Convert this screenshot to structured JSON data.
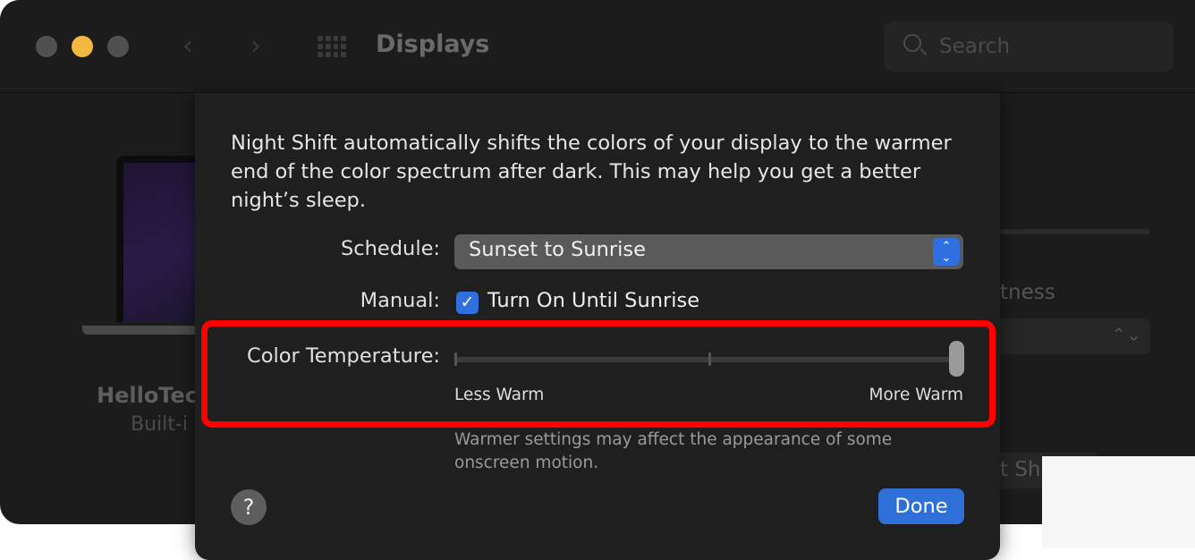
{
  "window": {
    "title": "Displays",
    "search_placeholder": "Search"
  },
  "background": {
    "display_name": "HelloTec",
    "display_sub": "Built-i",
    "brightness_partial": "tness",
    "button_partial": "t Sh"
  },
  "sheet": {
    "description": "Night Shift automatically shifts the colors of your display to the warmer end of the color spectrum after dark. This may help you get a better night’s sleep.",
    "schedule_label": "Schedule:",
    "schedule_value": "Sunset to Sunrise",
    "manual_label": "Manual:",
    "manual_checked": true,
    "manual_option": "Turn On Until Sunrise",
    "color_temp_label": "Color Temperature:",
    "color_temp_value_percent": 100,
    "less_warm": "Less Warm",
    "more_warm": "More Warm",
    "note": "Warmer settings may affect the appearance of some onscreen motion.",
    "help": "?",
    "done": "Done"
  },
  "colors": {
    "accent": "#2f6fd8",
    "highlight": "#ff0000",
    "minimize": "#f4b73f"
  }
}
